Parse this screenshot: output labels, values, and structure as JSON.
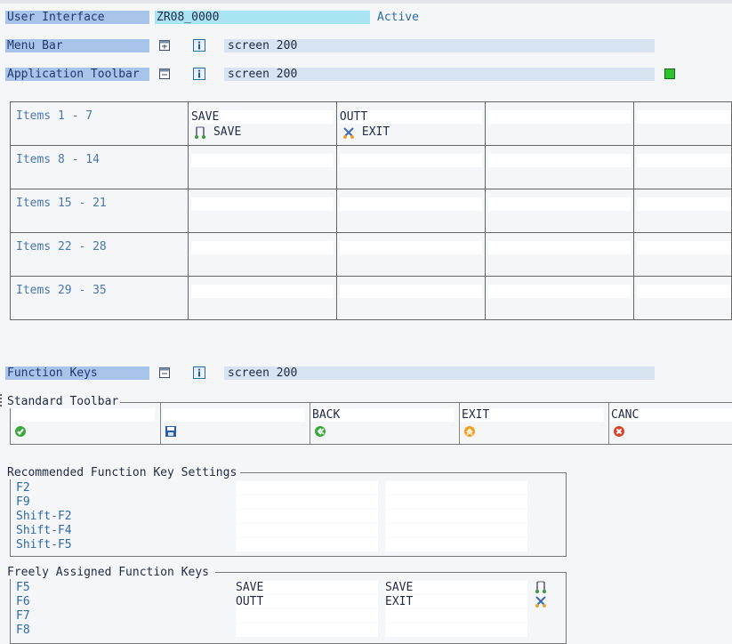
{
  "header": {
    "user_interface_label": "User Interface",
    "user_interface_value": "ZR08_0000",
    "status": "Active",
    "menu_bar_label": "Menu Bar",
    "menu_bar_value": "screen 200",
    "app_toolbar_label": "Application Toolbar",
    "app_toolbar_value": "screen 200"
  },
  "items_grid": {
    "rows": [
      "Items  1 -  7",
      "Items  8 - 14",
      "Items 15 - 21",
      "Items 22 - 28",
      "Items 29 - 35"
    ],
    "first_row_cells": [
      {
        "code": "SAVE",
        "text": "SAVE",
        "icon": "save-icon"
      },
      {
        "code": "OUTT",
        "text": "EXIT",
        "icon": "exit-icon"
      }
    ]
  },
  "function_keys": {
    "label": "Function Keys",
    "value": "screen 200"
  },
  "standard_toolbar": {
    "title": "Standard Toolbar",
    "cells": [
      {
        "code": "",
        "icon": "check-icon"
      },
      {
        "code": "",
        "icon": "floppy-save-icon"
      },
      {
        "code": "BACK",
        "icon": "back-icon"
      },
      {
        "code": "EXIT",
        "icon": "exit-up-icon"
      },
      {
        "code": "CANC",
        "icon": "cancel-icon"
      }
    ]
  },
  "recommended": {
    "title": "Recommended Function Key Settings",
    "keys": [
      "F2",
      "F9",
      "Shift-F2",
      "Shift-F4",
      "Shift-F5"
    ]
  },
  "freely": {
    "title": "Freely Assigned Function Keys",
    "keys": [
      "F5",
      "F6",
      "F7",
      "F8"
    ],
    "code1": [
      "SAVE",
      "OUTT",
      "",
      ""
    ],
    "code2": [
      "SAVE",
      "EXIT",
      "",
      ""
    ]
  },
  "colors": {
    "label_bg": "#a9c4ea",
    "field_bg": "#d9e4f2",
    "status_text": "#2d6aa8",
    "active_indicator": "#2ec22e"
  }
}
